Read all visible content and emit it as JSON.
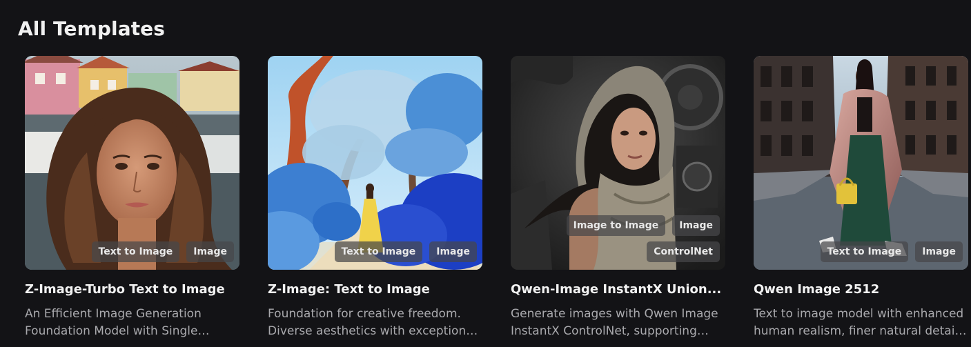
{
  "header": {
    "title": "All Templates"
  },
  "cards": [
    {
      "title": "Z-Image-Turbo Text to Image",
      "description": "An Efficient Image Generation Foundation Model with Single Stream Diffusion Transformer",
      "tags": [
        "Text to Image",
        "Image"
      ],
      "image": "portrait-woman-harbor"
    },
    {
      "title": "Z-Image: Text to Image",
      "description": "Foundation for creative freedom. Diverse aesthetics with exceptional detail",
      "tags": [
        "Text to Image",
        "Image"
      ],
      "image": "blue-trees-path"
    },
    {
      "title": "Qwen-Image InstantX Union...",
      "description": "Generate images with Qwen Image InstantX ControlNet, supporting canny, soft edge, depth, pose",
      "tags": [
        "Image to Image",
        "Image",
        "ControlNet"
      ],
      "image": "hooded-woman-machinery"
    },
    {
      "title": "Qwen Image 2512",
      "description": "Text to image model with enhanced human realism, finer natural details and better text rendering",
      "tags": [
        "Text to Image",
        "Image"
      ],
      "image": "woman-walking-street"
    }
  ],
  "colors": {
    "background": "#131316",
    "tag_background": "#46464a",
    "description_text": "#a9a9ad"
  }
}
